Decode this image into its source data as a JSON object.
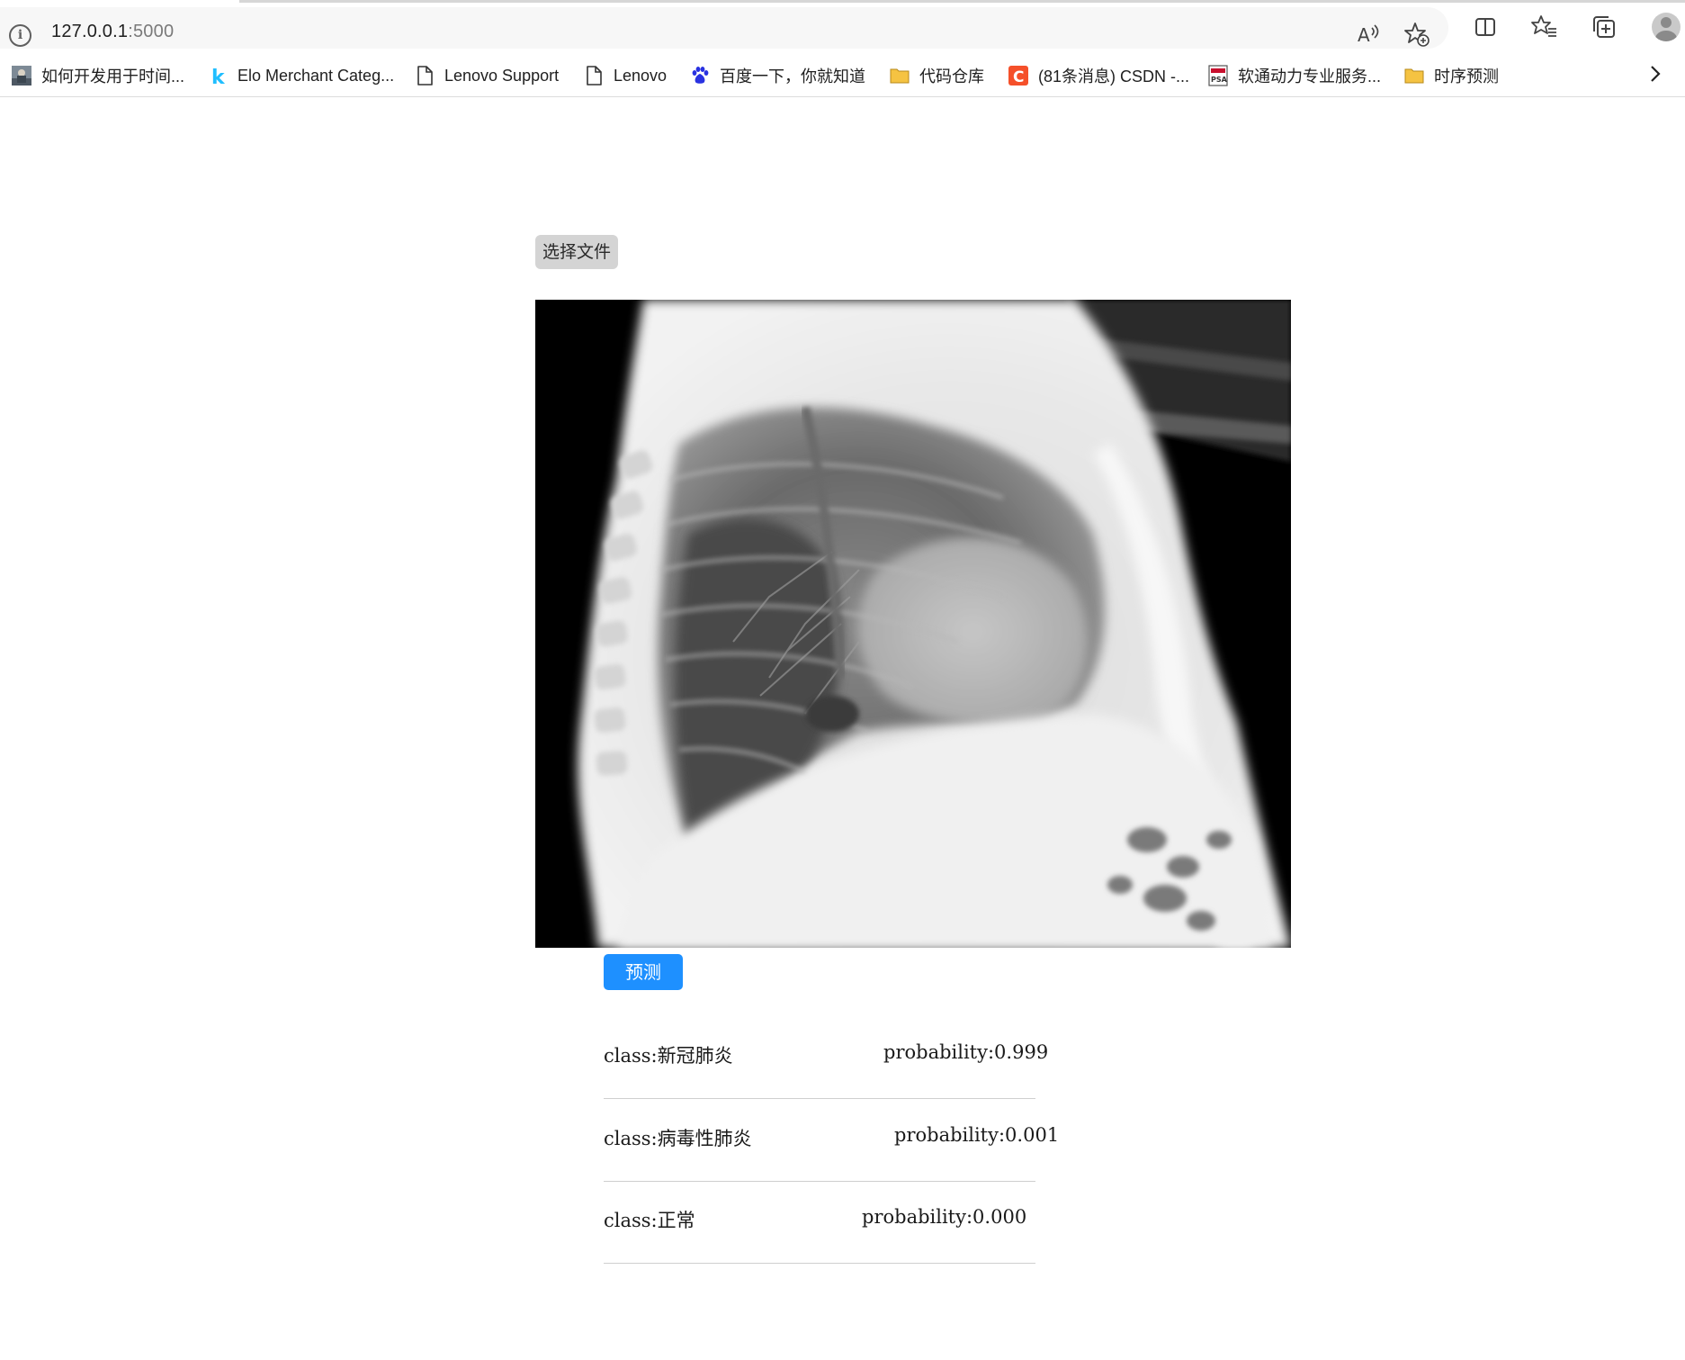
{
  "browser": {
    "url_host": "127.0.0.1",
    "url_port": ":5000",
    "toolbar_icons": [
      "read-aloud-icon",
      "add-favorite-icon",
      "split-screen-icon",
      "favorites-icon",
      "collections-icon",
      "profile-avatar"
    ],
    "bookmarks": [
      {
        "label": "如何开发用于时间...",
        "icon": "site-thumbnail-icon"
      },
      {
        "label": "Elo Merchant Categ...",
        "icon": "kaggle-k-icon"
      },
      {
        "label": "Lenovo Support",
        "icon": "page-icon"
      },
      {
        "label": "Lenovo",
        "icon": "page-icon"
      },
      {
        "label": "百度一下，你就知道",
        "icon": "baidu-paw-icon"
      },
      {
        "label": "代码仓库",
        "icon": "folder-icon"
      },
      {
        "label": "(81条消息) CSDN -...",
        "icon": "csdn-c-icon"
      },
      {
        "label": "软通动力专业服务...",
        "icon": "isoftstone-icon"
      },
      {
        "label": "时序预测",
        "icon": "folder-icon"
      }
    ]
  },
  "page": {
    "file_button_label": "选择文件",
    "image_description_icon": "chest-xray-image",
    "predict_button_label": "预测",
    "results": [
      {
        "class": "class:新冠肺炎",
        "probability": "probability:0.999"
      },
      {
        "class": "class:病毒性肺炎",
        "probability": "probability:0.001"
      },
      {
        "class": "class:正常",
        "probability": "probability:0.000"
      }
    ]
  },
  "colors": {
    "predict_button": "#1e90ff",
    "file_button": "#d4d4d4",
    "folder_icon": "#f5c342",
    "csdn_icon": "#f5502a",
    "kaggle_icon": "#20beff"
  }
}
